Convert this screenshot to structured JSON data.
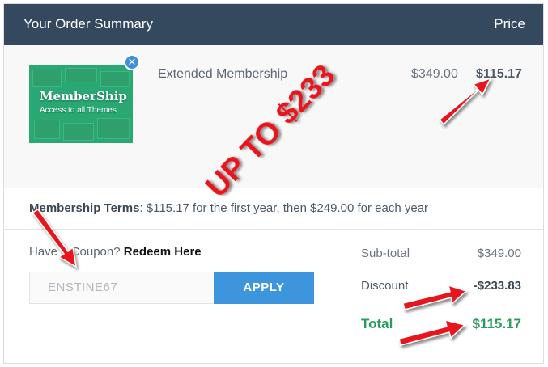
{
  "header": {
    "title": "Your Order Summary",
    "price_label": "Price"
  },
  "item": {
    "thumbnail": {
      "logo_title": "MemberShip",
      "logo_subtitle": "Access to all Themes"
    },
    "remove_icon": "close-icon",
    "name": "Extended Membership",
    "old_price": "$349.00",
    "new_price": "$115.17"
  },
  "terms": {
    "label": "Membership Terms",
    "text": ": $115.17 for the first year, then $249.00 for each year"
  },
  "coupon": {
    "prompt": "Have a Coupon? ",
    "link": "Redeem Here",
    "value": "ENSTINE67",
    "apply_label": "APPLY"
  },
  "totals": {
    "subtotal_label": "Sub-total",
    "subtotal_value": "$349.00",
    "discount_label": "Discount",
    "discount_value": "-$233.83",
    "total_label": "Total",
    "total_value": "$115.17"
  },
  "annotation": {
    "text": "UP TO $233",
    "color": "#e8141b"
  },
  "colors": {
    "header_bg": "#34495e",
    "accent": "#3d96dc",
    "total_green": "#2c9c5c",
    "arrow_red": "#e8141b"
  }
}
